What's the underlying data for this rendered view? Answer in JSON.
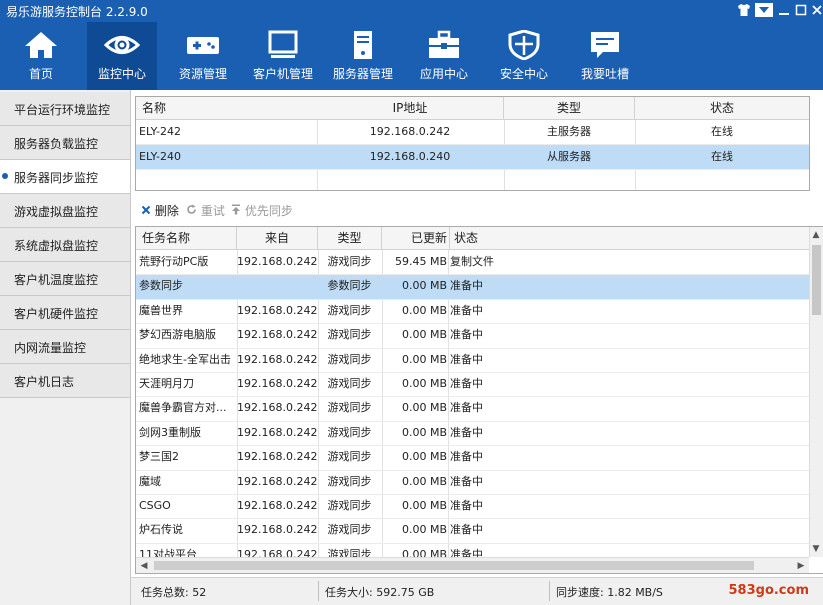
{
  "window": {
    "title": "易乐游服务控制台 2.2.9.0",
    "controls": [
      "shirt-icon",
      "dropdown-icon",
      "minimize-icon",
      "maximize-icon",
      "close-icon"
    ]
  },
  "nav": {
    "items": [
      {
        "label": "首页",
        "icon": "home-icon"
      },
      {
        "label": "监控中心",
        "icon": "eye-icon",
        "active": true
      },
      {
        "label": "资源管理",
        "icon": "gamepad-icon"
      },
      {
        "label": "客户机管理",
        "icon": "monitor-icon"
      },
      {
        "label": "服务器管理",
        "icon": "server-icon"
      },
      {
        "label": "应用中心",
        "icon": "toolbox-icon"
      },
      {
        "label": "安全中心",
        "icon": "shield-icon"
      },
      {
        "label": "我要吐槽",
        "icon": "feedback-icon"
      }
    ]
  },
  "sidebar": {
    "items": [
      {
        "label": "平台运行环境监控"
      },
      {
        "label": "服务器负载监控"
      },
      {
        "label": "服务器同步监控",
        "active": true
      },
      {
        "label": "游戏虚拟盘监控"
      },
      {
        "label": "系统虚拟盘监控"
      },
      {
        "label": "客户机温度监控"
      },
      {
        "label": "客户机硬件监控"
      },
      {
        "label": "内网流量监控"
      },
      {
        "label": "客户机日志"
      }
    ]
  },
  "servers": {
    "columns": [
      "名称",
      "IP地址",
      "类型",
      "状态"
    ],
    "rows": [
      {
        "name": "ELY-242",
        "ip": "192.168.0.242",
        "type": "主服务器",
        "status": "在线"
      },
      {
        "name": "ELY-240",
        "ip": "192.168.0.240",
        "type": "从服务器",
        "status": "在线"
      }
    ]
  },
  "toolbar": {
    "delete": "删除",
    "retry": "重试",
    "priority": "优先同步"
  },
  "tasks": {
    "columns": [
      "任务名称",
      "来自",
      "类型",
      "已更新",
      "状态"
    ],
    "rows": [
      {
        "name": "荒野行动PC版",
        "from": "192.168.0.242",
        "type": "游戏同步",
        "updated": "59.45 MB",
        "status": "复制文件"
      },
      {
        "name": "参数同步",
        "from": "",
        "type": "参数同步",
        "updated": "0.00 MB",
        "status": "准备中"
      },
      {
        "name": "魔兽世界",
        "from": "192.168.0.242",
        "type": "游戏同步",
        "updated": "0.00 MB",
        "status": "准备中"
      },
      {
        "name": "梦幻西游电脑版",
        "from": "192.168.0.242",
        "type": "游戏同步",
        "updated": "0.00 MB",
        "status": "准备中"
      },
      {
        "name": "绝地求生-全军出击",
        "from": "192.168.0.242",
        "type": "游戏同步",
        "updated": "0.00 MB",
        "status": "准备中"
      },
      {
        "name": "天涯明月刀",
        "from": "192.168.0.242",
        "type": "游戏同步",
        "updated": "0.00 MB",
        "status": "准备中"
      },
      {
        "name": "魔兽争霸官方对...",
        "from": "192.168.0.242",
        "type": "游戏同步",
        "updated": "0.00 MB",
        "status": "准备中"
      },
      {
        "name": "剑网3重制版",
        "from": "192.168.0.242",
        "type": "游戏同步",
        "updated": "0.00 MB",
        "status": "准备中"
      },
      {
        "name": "梦三国2",
        "from": "192.168.0.242",
        "type": "游戏同步",
        "updated": "0.00 MB",
        "status": "准备中"
      },
      {
        "name": "魔域",
        "from": "192.168.0.242",
        "type": "游戏同步",
        "updated": "0.00 MB",
        "status": "准备中"
      },
      {
        "name": "CSGO",
        "from": "192.168.0.242",
        "type": "游戏同步",
        "updated": "0.00 MB",
        "status": "准备中"
      },
      {
        "name": "炉石传说",
        "from": "192.168.0.242",
        "type": "游戏同步",
        "updated": "0.00 MB",
        "status": "准备中"
      },
      {
        "name": "11对战平台",
        "from": "192.168.0.242",
        "type": "游戏同步",
        "updated": "0.00 MB",
        "status": "准备中"
      }
    ]
  },
  "status": {
    "total": "任务总数: 52",
    "size": "任务大小: 592.75 GB",
    "speed": "同步速度: 1.82 MB/S",
    "watermark": "583go.com"
  },
  "colors": {
    "accent": "#1b5fb2",
    "active_nav": "#0f4a95",
    "selection": "#bedcf6"
  }
}
